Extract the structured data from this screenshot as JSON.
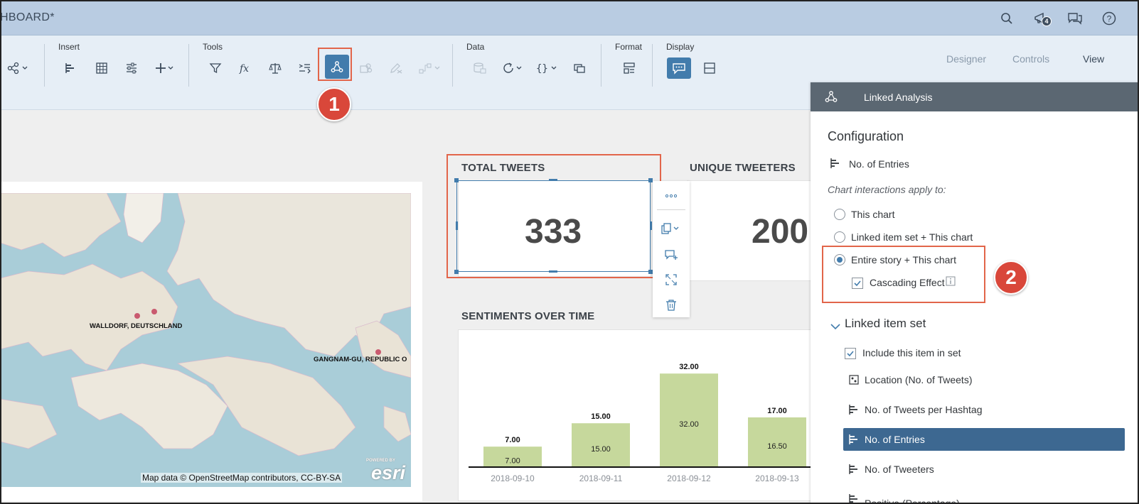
{
  "shell": {
    "title": "HBOARD*",
    "notification_count": "4"
  },
  "toolbar": {
    "groups": {
      "insert": "Insert",
      "tools": "Tools",
      "data": "Data",
      "format": "Format",
      "display": "Display"
    },
    "view_tabs": [
      "Designer",
      "Controls",
      "View"
    ],
    "active_view_tab": "View"
  },
  "callouts": [
    "1",
    "2"
  ],
  "map": {
    "labels": [
      "WALLDORF, DEUTSCHLAND",
      "GANGNAM-GU, REPUBLIC O"
    ],
    "attribution": "Map data © OpenStreetMap contributors, CC-BY-SA",
    "powered_by": "POWERED BY",
    "logo": "esri"
  },
  "kpis": {
    "total_tweets": {
      "title": "TOTAL TWEETS",
      "value": "333"
    },
    "unique_tweeters": {
      "title": "UNIQUE TWEETERS",
      "value": "200"
    }
  },
  "sentiments": {
    "title": "SENTIMENTS OVER TIME"
  },
  "chart_data": {
    "type": "bar",
    "title": "SENTIMENTS OVER TIME",
    "categories": [
      "2018-09-10",
      "2018-09-11",
      "2018-09-12",
      "2018-09-13"
    ],
    "values": [
      7.0,
      15.0,
      32.0,
      17.0
    ],
    "top_labels": [
      "7.00",
      "15.00",
      "32.00",
      "17.00"
    ],
    "inner_labels": [
      "7.00",
      "15.00",
      "32.00",
      "16.50"
    ],
    "ylim": [
      0,
      34
    ],
    "bar_color": "#c6d89c",
    "grid": false
  },
  "panel": {
    "title": "Linked Analysis",
    "configuration": "Configuration",
    "entry_label": "No. of Entries",
    "interactions_label": "Chart interactions apply to:",
    "options": [
      "This chart",
      "Linked item set + This chart",
      "Entire story + This chart"
    ],
    "selected_option": 2,
    "cascading": "Cascading Effect",
    "linked_set_title": "Linked item set",
    "include_label": "Include this item in set",
    "items": [
      "Location (No. of Tweets)",
      "No. of Tweets per Hashtag",
      "No. of Entries",
      "No. of Tweeters",
      "Positive (Percentage)"
    ],
    "selected_item": 2
  },
  "colors": {
    "accent": "#427cac",
    "callout": "#d9473a",
    "shell": "#b9cce2",
    "selected_row": "#3d6891"
  }
}
